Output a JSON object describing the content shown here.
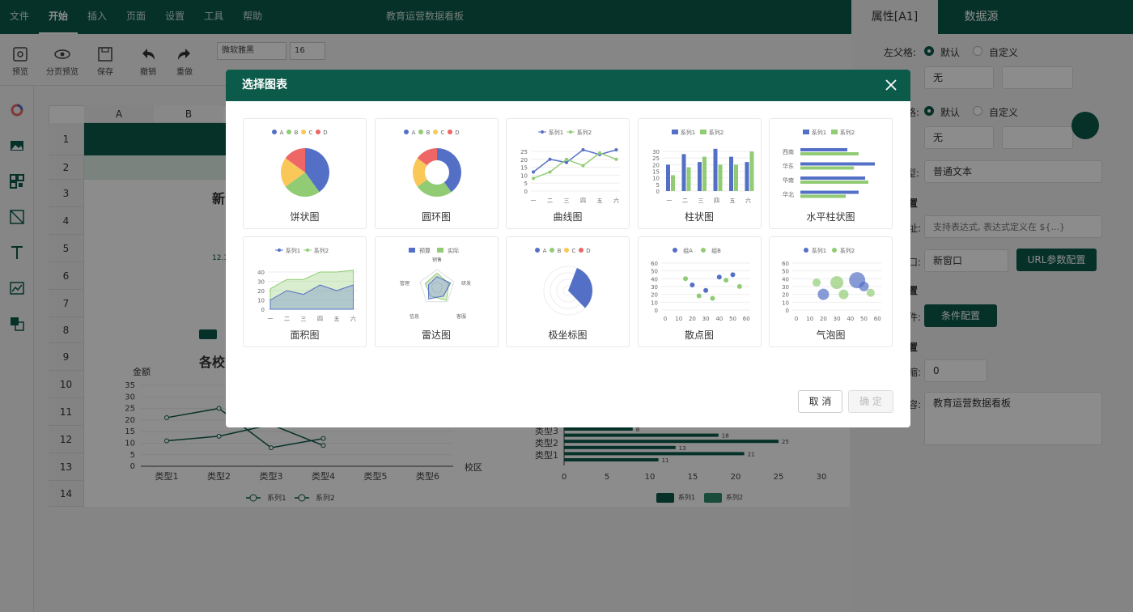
{
  "menu": [
    "文件",
    "开始",
    "插入",
    "页面",
    "设置",
    "工具",
    "帮助"
  ],
  "app_title": "教育运营数据看板",
  "toolbar": {
    "preview": "预览",
    "page_preview": "分页预览",
    "save": "保存",
    "undo": "撤销",
    "redo": "重做",
    "font_name": "微软雅黑",
    "font_size": "16"
  },
  "sheet": {
    "col_a": "A",
    "col_b": "B",
    "rows": [
      "1",
      "2",
      "3",
      "4",
      "5",
      "6",
      "7",
      "8",
      "9",
      "10",
      "11",
      "12",
      "13",
      "14"
    ],
    "chart1_title": "各校",
    "chart1_ylabel": "金额",
    "chart1_xlabel": "校区",
    "chart1_y_ticks": [
      "35",
      "30",
      "25",
      "20",
      "15",
      "10",
      "5",
      "0"
    ],
    "chart1_x_ticks": [
      "类型1",
      "类型2",
      "类型3",
      "类型4",
      "类型5",
      "类型6"
    ],
    "legend_s1": "系列1",
    "legend_s2": "系列2",
    "hbar_cats": [
      "类型3",
      "类型2",
      "类型1"
    ],
    "hbar_vals": [
      "8",
      "18",
      "25",
      "13",
      "21",
      "11"
    ],
    "hbar_x_ticks": [
      "0",
      "5",
      "10",
      "15",
      "20",
      "25",
      "30"
    ],
    "partial_title": "新",
    "partial_value": "12.1"
  },
  "right_panel": {
    "tab_props": "属性[A1]",
    "tab_data": "数据源",
    "left_parent": "左父格:",
    "default": "默认",
    "custom": "自定义",
    "none": "无",
    "row_parent": "格:",
    "type_label": "型:",
    "type_value": "普通文本",
    "section1": "置",
    "expr_label": "址:",
    "expr_placeholder": "支持表达式, 表达式定义在 ${...}",
    "open_label": "口:",
    "open_value": "新窗口",
    "url_btn": "URL参数配置",
    "section2": "置",
    "cond_label": "件:",
    "cond_btn": "条件配置",
    "section3": "置",
    "indent_label": "缩:",
    "indent_value": "0",
    "text_label": "容:",
    "text_value": "教育运营数据看板"
  },
  "dialog": {
    "title": "选择图表",
    "cancel": "取 消",
    "confirm": "确 定",
    "charts": [
      {
        "label": "饼状图"
      },
      {
        "label": "圆环图"
      },
      {
        "label": "曲线图"
      },
      {
        "label": "柱状图"
      },
      {
        "label": "水平柱状图"
      },
      {
        "label": "面积图"
      },
      {
        "label": "雷达图"
      },
      {
        "label": "极坐标图"
      },
      {
        "label": "散点图"
      },
      {
        "label": "气泡图"
      }
    ],
    "legend_abcd": [
      "A",
      "B",
      "C",
      "D"
    ],
    "legend_series": [
      "系列1",
      "系列2"
    ],
    "legend_radar": [
      "预算",
      "实际"
    ],
    "radar_axes": [
      "销售",
      "管理",
      "研发",
      "信息",
      "客服"
    ],
    "legend_scatter": [
      "组A",
      "组B"
    ],
    "weekdays": [
      "一",
      "二",
      "三",
      "四",
      "五",
      "六"
    ],
    "regions": [
      "西南",
      "华东",
      "华南",
      "华北"
    ],
    "line_y": [
      "25",
      "20",
      "15",
      "10",
      "5",
      "0"
    ],
    "bar_y": [
      "30",
      "25",
      "20",
      "15",
      "10",
      "5",
      "0"
    ],
    "area_y": [
      "40",
      "30",
      "20",
      "10",
      "0"
    ],
    "scatter_y": [
      "60",
      "50",
      "40",
      "30",
      "20",
      "10",
      "0"
    ],
    "scatter_x": [
      "0",
      "10",
      "20",
      "30",
      "40",
      "50",
      "60"
    ]
  },
  "colors": {
    "brand": "#0b5a4a",
    "blue": "#5470c6",
    "green": "#91cc75",
    "yellow": "#fac858",
    "red": "#ee6666"
  }
}
